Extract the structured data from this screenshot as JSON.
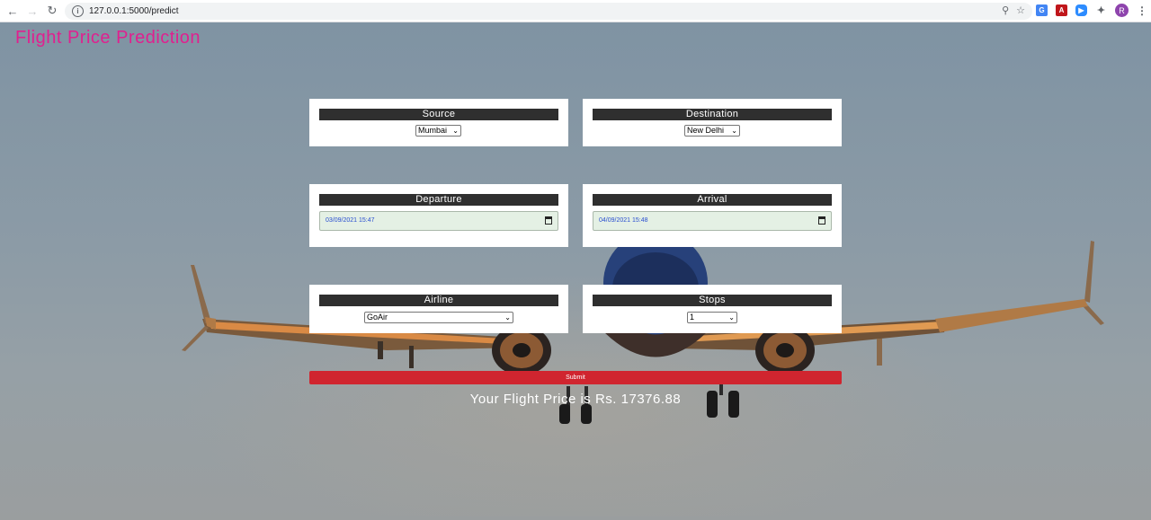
{
  "browser": {
    "url": "127.0.0.1:5000/predict",
    "profile_initial": "R",
    "icons": [
      "back-icon",
      "forward-icon",
      "reload-icon",
      "info-icon",
      "zoom-icon",
      "star-icon",
      "translate-extension-icon",
      "pdf-extension-icon",
      "zoom-extension-icon",
      "puzzle-icon",
      "menu-icon"
    ]
  },
  "page": {
    "title": "Flight Price Prediction",
    "title_color": "#e0208f"
  },
  "form": {
    "source": {
      "label": "Source",
      "value": "Mumbai"
    },
    "destination": {
      "label": "Destination",
      "value": "New Delhi"
    },
    "departure": {
      "label": "Departure",
      "value": "03/09/2021 15:47"
    },
    "arrival": {
      "label": "Arrival",
      "value": "04/09/2021 15:48"
    },
    "airline": {
      "label": "Airline",
      "value": "GoAir"
    },
    "stops": {
      "label": "Stops",
      "value": "1"
    },
    "submit_label": "Submit",
    "submit_color": "#d0252f"
  },
  "result_text": "Your Flight Price is Rs. 17376.88"
}
